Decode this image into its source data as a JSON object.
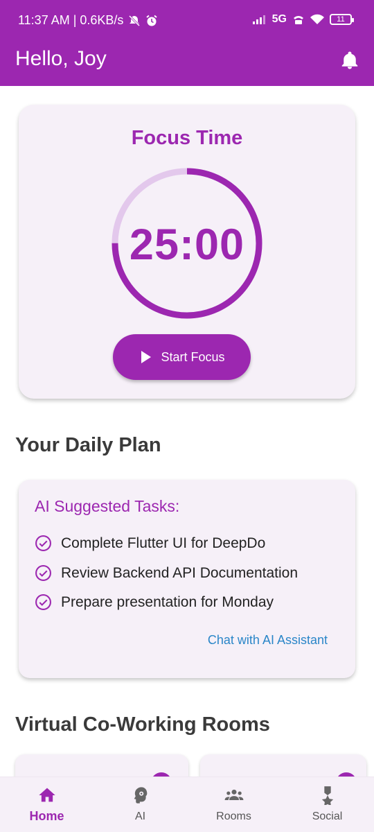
{
  "status_bar": {
    "time_speed": "11:37 AM | 0.6KB/s",
    "network": "5G",
    "battery": "11"
  },
  "app_bar": {
    "title": "Hello, Joy"
  },
  "focus": {
    "title": "Focus Time",
    "timer": "25:00",
    "progress": 0.75,
    "start_label": "Start Focus"
  },
  "daily_plan": {
    "section_title": "Your Daily Plan",
    "heading": "AI Suggested Tasks:",
    "tasks": [
      "Complete Flutter UI for DeepDo",
      "Review Backend API Documentation",
      "Prepare presentation for Monday"
    ],
    "chat_link": "Chat with AI Assistant"
  },
  "rooms": {
    "section_title": "Virtual Co-Working Rooms"
  },
  "nav": {
    "items": [
      {
        "label": "Home",
        "icon": "home-icon",
        "active": true
      },
      {
        "label": "AI",
        "icon": "ai-head-icon",
        "active": false
      },
      {
        "label": "Rooms",
        "icon": "group-icon",
        "active": false
      },
      {
        "label": "Social",
        "icon": "medal-icon",
        "active": false
      }
    ]
  },
  "colors": {
    "primary": "#9c27b0",
    "card_bg": "#f6f0f8",
    "link": "#2a86c8",
    "ring_track": "#e3c8ec"
  }
}
